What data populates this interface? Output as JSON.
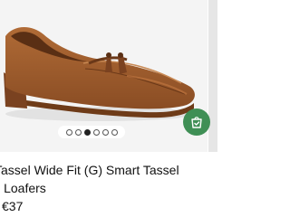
{
  "product": {
    "title_line1": "Tassel Wide Fit (G) Smart Tassel",
    "title_line2": "il Loafers",
    "price": "€37"
  },
  "carousel": {
    "image_count": 6,
    "active_index": 2
  },
  "colors": {
    "bag_button": "#3f8f55",
    "image_background": "#f4f4f4",
    "shoe_leather": "#9a5a2c"
  },
  "icons": {
    "bag_button": "shopping-bag-check-icon"
  }
}
